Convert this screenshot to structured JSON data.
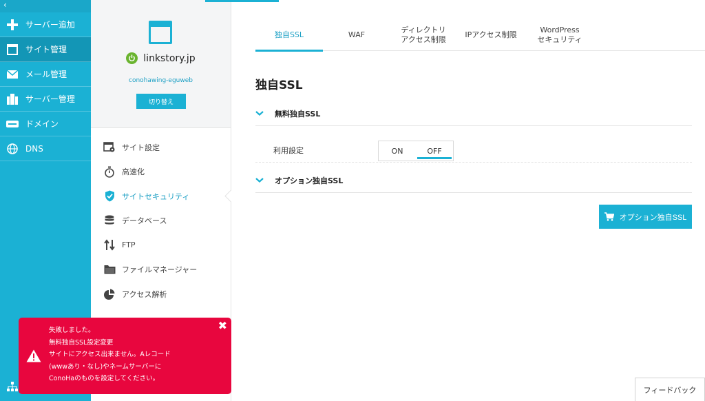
{
  "sidebar": {
    "collapse_glyph": "‹",
    "items": [
      {
        "label": "サーバー追加",
        "icon": "plus-icon"
      },
      {
        "label": "サイト管理",
        "icon": "window-icon"
      },
      {
        "label": "メール管理",
        "icon": "mail-icon"
      },
      {
        "label": "サーバー管理",
        "icon": "server-icon"
      },
      {
        "label": "ドメイン",
        "icon": "domain-icon"
      },
      {
        "label": "DNS",
        "icon": "globe-icon"
      }
    ],
    "active_index": 1
  },
  "site": {
    "name": "linkstory.jp",
    "account": "conohawing-eguweb",
    "switch_label": "切り替え"
  },
  "site_menu": {
    "items": [
      {
        "label": "サイト設定",
        "icon": "site-settings-icon"
      },
      {
        "label": "高速化",
        "icon": "stopwatch-icon"
      },
      {
        "label": "サイトセキュリティ",
        "icon": "shield-check-icon"
      },
      {
        "label": "データベース",
        "icon": "database-icon"
      },
      {
        "label": "FTP",
        "icon": "transfer-arrows-icon"
      },
      {
        "label": "ファイルマネージャー",
        "icon": "folder-icon"
      },
      {
        "label": "アクセス解析",
        "icon": "pie-chart-icon"
      }
    ],
    "active_index": 2
  },
  "tabs": [
    {
      "line1": "独自SSL",
      "line2": ""
    },
    {
      "line1": "WAF",
      "line2": ""
    },
    {
      "line1": "ディレクトリ",
      "line2": "アクセス制限"
    },
    {
      "line1": "IPアクセス制限",
      "line2": ""
    },
    {
      "line1": "WordPress",
      "line2": "セキュリティ"
    }
  ],
  "active_tab": 0,
  "page": {
    "title": "独自SSL",
    "free_ssl_section": "無料独自SSL",
    "usage_label": "利用設定",
    "toggle_on": "ON",
    "toggle_off": "OFF",
    "toggle_selected": "OFF",
    "option_ssl_section": "オプション独自SSL",
    "cart_button": "オプション独自SSL"
  },
  "toast": {
    "lines": [
      "失敗しました。",
      "無料独自SSL設定変更",
      "サイトにアクセス出来ません。Aレコード",
      "(wwwあり・なし)やネームサーバーに",
      "ConoHaのものを設定してください。"
    ],
    "close_glyph": "✖"
  },
  "feedback_label": "フィードバック",
  "colors": {
    "accent": "#1bb1d4",
    "error": "#e8063e",
    "online": "#6ab42f"
  }
}
